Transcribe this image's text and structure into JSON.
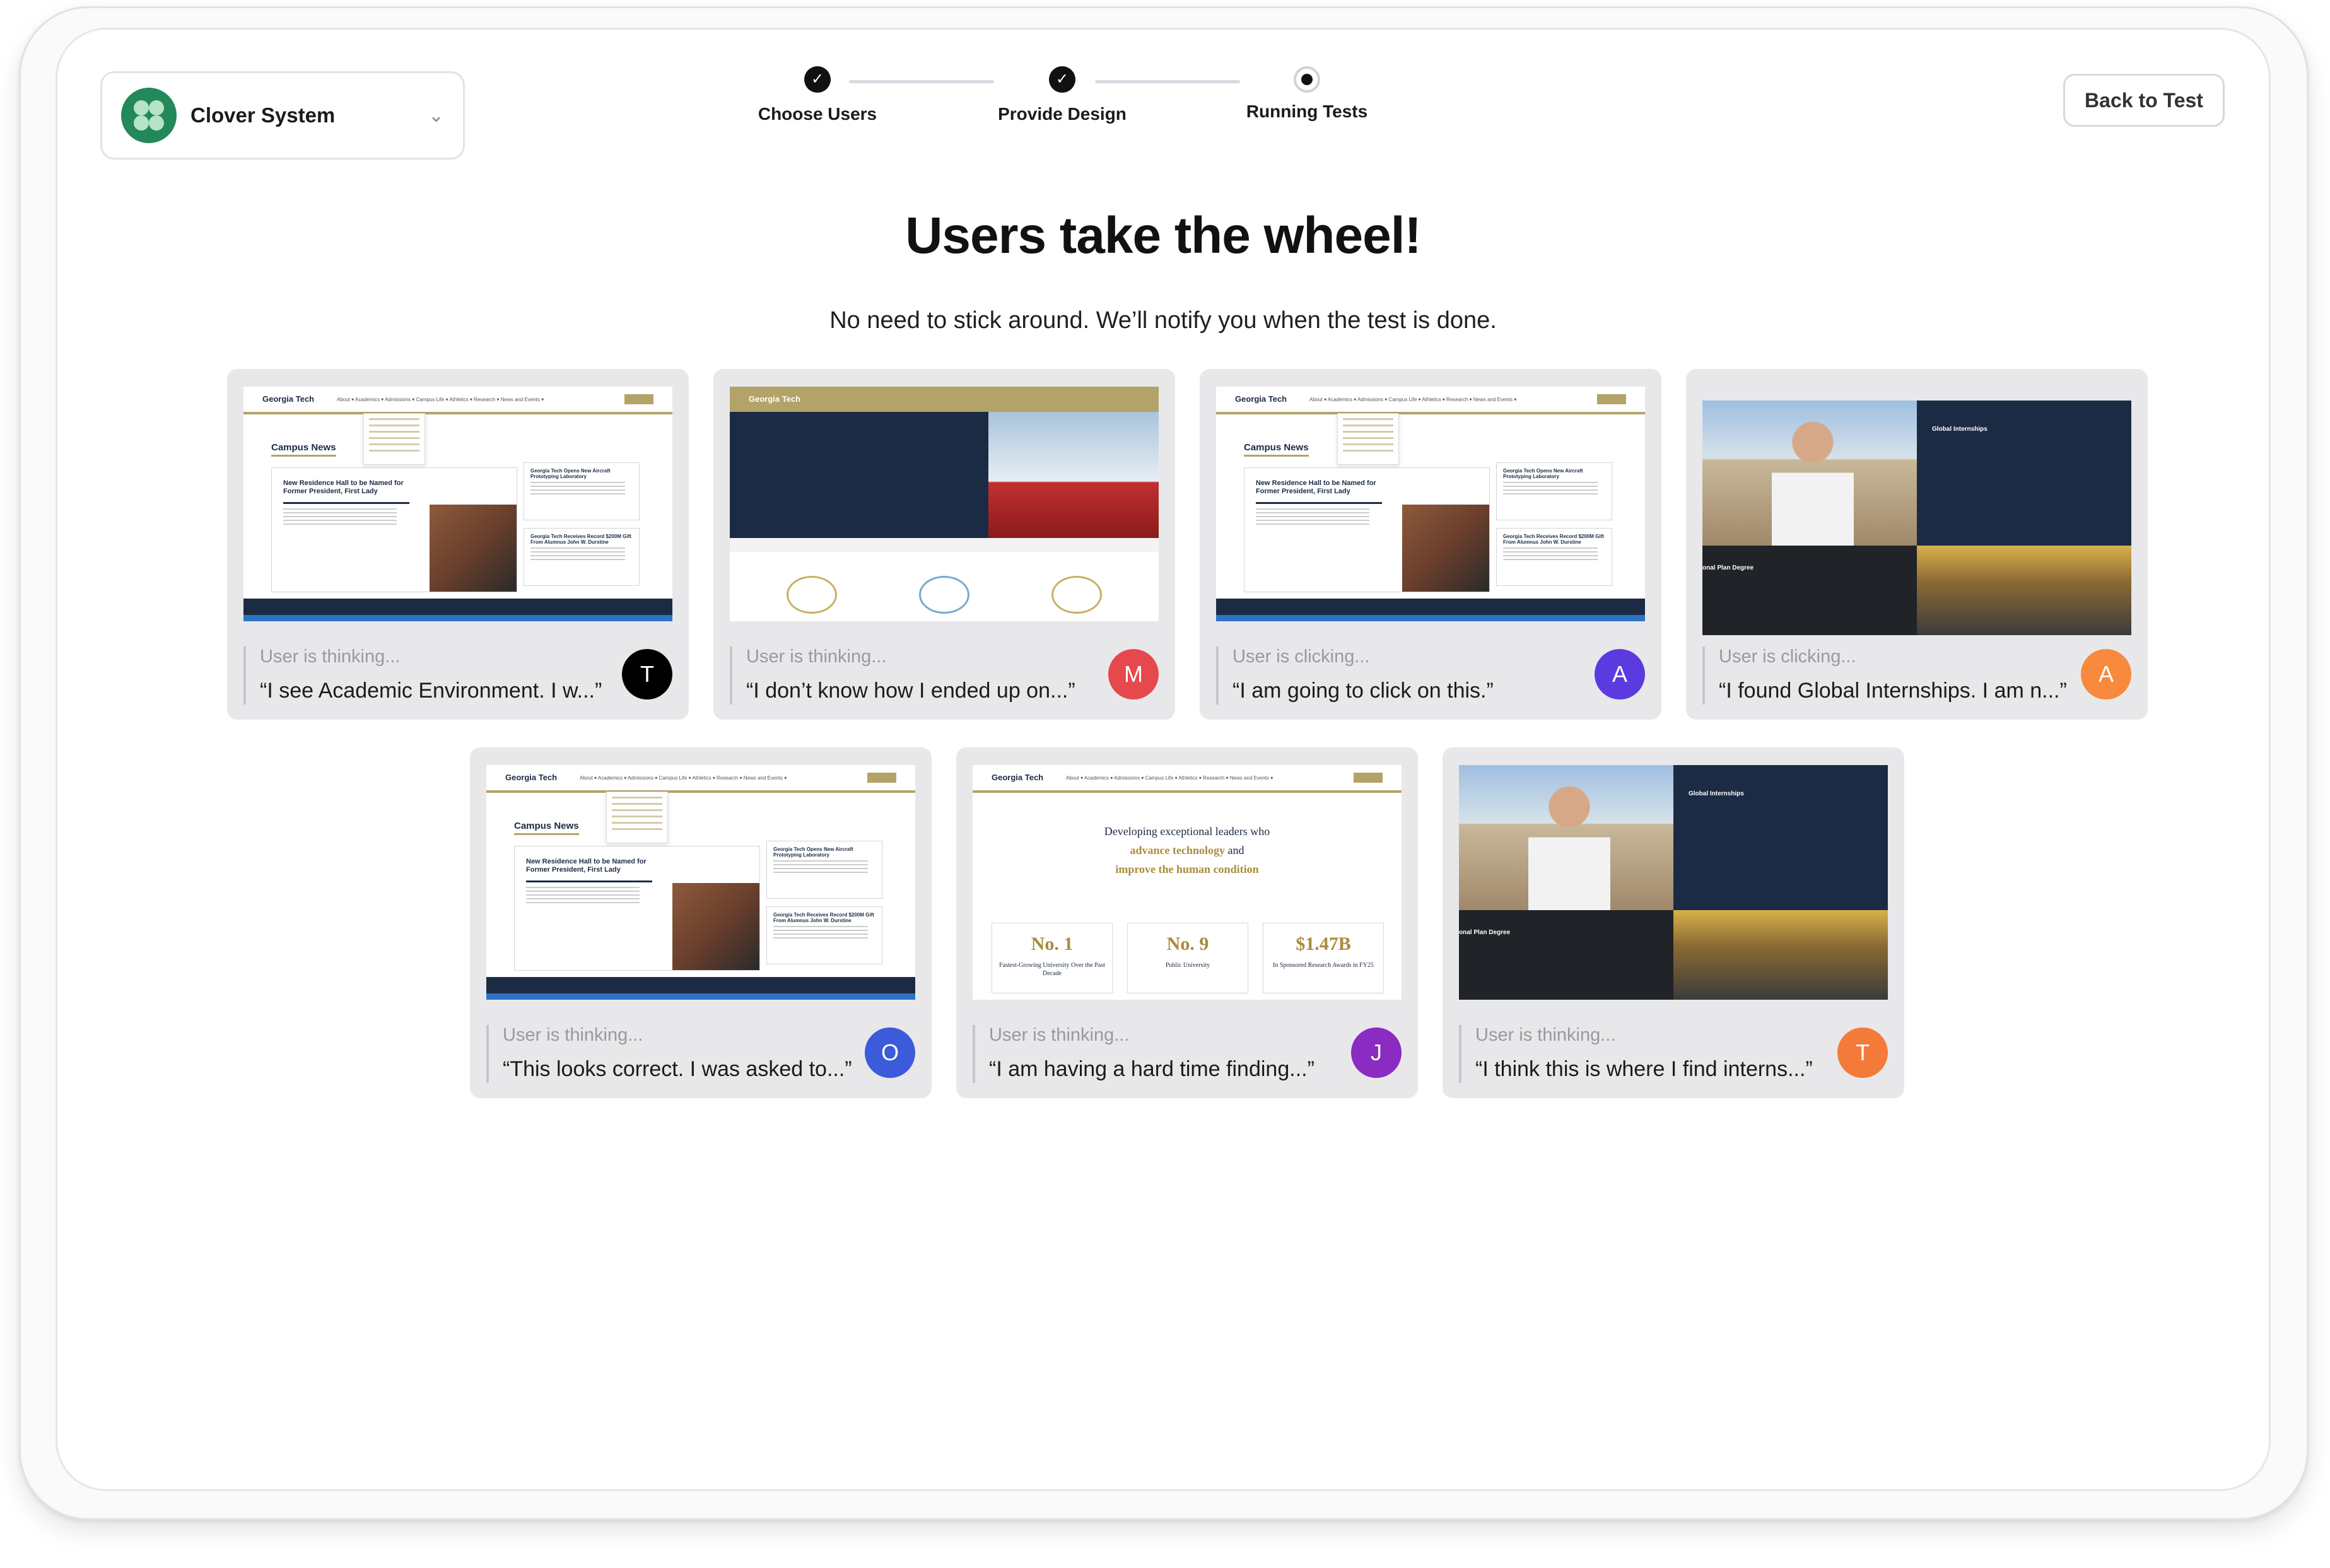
{
  "workspace": {
    "name": "Clover System"
  },
  "stepper": [
    {
      "label": "Choose Users",
      "state": "done"
    },
    {
      "label": "Provide Design",
      "state": "done"
    },
    {
      "label": "Running Tests",
      "state": "current"
    }
  ],
  "back_button": "Back to Test",
  "title": "Users take the wheel!",
  "subtitle": "No need to stick around. We’ll notify you when the test is done.",
  "cards": [
    {
      "status": "User is thinking...",
      "quote": "“I see Academic Environment. I w...”",
      "avatar": "T",
      "avatar_color": "#000000"
    },
    {
      "status": "User is thinking...",
      "quote": "“I don’t know how I ended up on...”",
      "avatar": "M",
      "avatar_color": "#e5484d"
    },
    {
      "status": "User is clicking...",
      "quote": "“I am going to click on this.”",
      "avatar": "A",
      "avatar_color": "#5b3be0"
    },
    {
      "status": "User is clicking...",
      "quote": "“I found Global Internships. I am n...”",
      "avatar": "A",
      "avatar_color": "#f78a3c"
    },
    {
      "status": "User is thinking...",
      "quote": "“This looks correct. I was asked to...”",
      "avatar": "O",
      "avatar_color": "#3b5bdb"
    },
    {
      "status": "User is thinking...",
      "quote": "“I am having a hard time finding...”",
      "avatar": "J",
      "avatar_color": "#8a2bc2"
    },
    {
      "status": "User is thinking...",
      "quote": "“I think this is where I find interns...”",
      "avatar": "T",
      "avatar_color": "#f47a3a"
    }
  ],
  "screens": {
    "campus_news": {
      "logo": "Georgia Tech",
      "nav": "About ▾  Academics ▾  Admissions ▾  Campus Life ▾  Athletics ▾  Research ▾  News and Events ▾",
      "section": "Campus News",
      "feature": "New Residence Hall to be Named for Former President, First Lady",
      "side1": "Georgia Tech Opens New Aircraft Prototyping Laboratory",
      "side2": "Georgia Tech Receives Record $200M Gift From Alumnus John W. Durstine"
    },
    "academics": {
      "logo": "Georgia Tech"
    },
    "internships": {
      "heading": "Global Internships",
      "subheading": "onal Plan Degree"
    },
    "home": {
      "tagline_1": "Developing exceptional leaders who",
      "tagline_2": "advance technology",
      "tagline_2b": " and",
      "tagline_3": "improve the human condition",
      "stats": [
        {
          "n": "No. 1",
          "l": "Fastest-Growing University Over the Past Decade"
        },
        {
          "n": "No. 9",
          "l": "Public University"
        },
        {
          "n": "$1.47B",
          "l": "In Sponsored Research Awards in FY25"
        }
      ]
    }
  }
}
